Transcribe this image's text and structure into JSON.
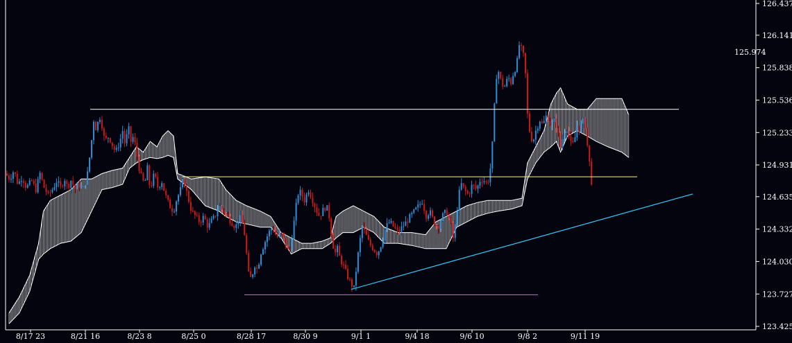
{
  "colors": {
    "background": "#04040f",
    "axis": "#ffffff",
    "up_candle": "#2a8fd6",
    "down_candle": "#d01818",
    "cloud": "#cfcfcf",
    "cloud_edge": "#ffffff",
    "resistance_1": "#ffffff",
    "resistance_2": "#ffff66",
    "support": "#ff44ff",
    "trendline": "#33ccff"
  },
  "chart_data": {
    "type": "candlestick",
    "x_axis": {
      "tick_labels": [
        "8/17 23",
        "8/21 16",
        "8/23 8",
        "8/25 0",
        "8/28 17",
        "8/30 9",
        "9/1 1",
        "9/4 18",
        "9/6 10",
        "9/8 2",
        "9/11 19"
      ]
    },
    "y_axis": {
      "ylim": [
        123.425,
        126.437
      ],
      "tick_labels": [
        "126.437",
        "126.141",
        "125.838",
        "125.536",
        "125.233",
        "124.931",
        "124.635",
        "124.332",
        "124.030",
        "123.727",
        "123.425"
      ],
      "ticks": [
        126.437,
        126.141,
        125.838,
        125.536,
        125.233,
        124.931,
        124.635,
        124.332,
        124.03,
        123.727,
        123.425
      ]
    },
    "current_price": "125.974",
    "price_path": [
      [
        0,
        124.85
      ],
      [
        6,
        124.8
      ],
      [
        12,
        124.88
      ],
      [
        18,
        124.75
      ],
      [
        24,
        124.82
      ],
      [
        30,
        124.72
      ],
      [
        38,
        124.78
      ],
      [
        44,
        124.7
      ],
      [
        50,
        124.85
      ],
      [
        56,
        124.72
      ],
      [
        62,
        124.65
      ],
      [
        68,
        124.7
      ],
      [
        74,
        124.78
      ],
      [
        80,
        124.72
      ],
      [
        86,
        124.8
      ],
      [
        90,
        124.72
      ],
      [
        96,
        124.8
      ],
      [
        100,
        124.7
      ],
      [
        106,
        124.75
      ],
      [
        112,
        124.7
      ],
      [
        118,
        124.8
      ],
      [
        124,
        125.1
      ],
      [
        128,
        125.35
      ],
      [
        132,
        125.25
      ],
      [
        136,
        125.4
      ],
      [
        140,
        125.3
      ],
      [
        144,
        125.15
      ],
      [
        150,
        125.2
      ],
      [
        156,
        125.1
      ],
      [
        160,
        125.05
      ],
      [
        166,
        125.15
      ],
      [
        170,
        125.25
      ],
      [
        174,
        125.1
      ],
      [
        178,
        125.3
      ],
      [
        182,
        125.15
      ],
      [
        186,
        125.2
      ],
      [
        190,
        125.05
      ],
      [
        194,
        124.9
      ],
      [
        198,
        124.8
      ],
      [
        202,
        124.75
      ],
      [
        206,
        124.9
      ],
      [
        210,
        124.7
      ],
      [
        216,
        124.85
      ],
      [
        222,
        124.7
      ],
      [
        226,
        124.8
      ],
      [
        232,
        124.65
      ],
      [
        238,
        124.55
      ],
      [
        244,
        124.5
      ],
      [
        248,
        124.6
      ],
      [
        254,
        124.7
      ],
      [
        258,
        124.8
      ],
      [
        262,
        124.7
      ],
      [
        266,
        124.6
      ],
      [
        270,
        124.5
      ],
      [
        276,
        124.45
      ],
      [
        282,
        124.4
      ],
      [
        288,
        124.45
      ],
      [
        294,
        124.35
      ],
      [
        298,
        124.4
      ],
      [
        304,
        124.45
      ],
      [
        310,
        124.55
      ],
      [
        316,
        124.5
      ],
      [
        322,
        124.45
      ],
      [
        328,
        124.4
      ],
      [
        334,
        124.35
      ],
      [
        340,
        124.45
      ],
      [
        346,
        124.35
      ],
      [
        350,
        124.1
      ],
      [
        354,
        123.85
      ],
      [
        358,
        123.9
      ],
      [
        362,
        124.0
      ],
      [
        366,
        123.95
      ],
      [
        370,
        124.1
      ],
      [
        376,
        124.2
      ],
      [
        382,
        124.3
      ],
      [
        388,
        124.35
      ],
      [
        394,
        124.25
      ],
      [
        400,
        124.3
      ],
      [
        406,
        124.2
      ],
      [
        412,
        124.1
      ],
      [
        418,
        124.35
      ],
      [
        422,
        124.55
      ],
      [
        426,
        124.7
      ],
      [
        430,
        124.65
      ],
      [
        434,
        124.6
      ],
      [
        440,
        124.7
      ],
      [
        446,
        124.6
      ],
      [
        452,
        124.5
      ],
      [
        456,
        124.45
      ],
      [
        460,
        124.5
      ],
      [
        466,
        124.55
      ],
      [
        470,
        124.45
      ],
      [
        474,
        124.25
      ],
      [
        478,
        124.1
      ],
      [
        482,
        124.15
      ],
      [
        486,
        124.05
      ],
      [
        490,
        124.0
      ],
      [
        496,
        123.9
      ],
      [
        502,
        123.82
      ],
      [
        506,
        123.78
      ],
      [
        510,
        124.0
      ],
      [
        514,
        124.2
      ],
      [
        518,
        124.35
      ],
      [
        522,
        124.3
      ],
      [
        528,
        124.2
      ],
      [
        534,
        124.15
      ],
      [
        540,
        124.1
      ],
      [
        546,
        124.2
      ],
      [
        552,
        124.35
      ],
      [
        558,
        124.4
      ],
      [
        564,
        124.35
      ],
      [
        570,
        124.3
      ],
      [
        576,
        124.35
      ],
      [
        582,
        124.4
      ],
      [
        588,
        124.45
      ],
      [
        594,
        124.5
      ],
      [
        600,
        124.55
      ],
      [
        606,
        124.6
      ],
      [
        610,
        124.45
      ],
      [
        616,
        124.5
      ],
      [
        622,
        124.4
      ],
      [
        628,
        124.35
      ],
      [
        634,
        124.45
      ],
      [
        640,
        124.5
      ],
      [
        646,
        124.4
      ],
      [
        650,
        124.25
      ],
      [
        654,
        124.4
      ],
      [
        658,
        124.65
      ],
      [
        662,
        124.75
      ],
      [
        666,
        124.7
      ],
      [
        672,
        124.65
      ],
      [
        678,
        124.75
      ],
      [
        684,
        124.7
      ],
      [
        690,
        124.8
      ],
      [
        696,
        124.78
      ],
      [
        700,
        124.75
      ],
      [
        704,
        124.9
      ],
      [
        708,
        125.2
      ],
      [
        712,
        125.75
      ],
      [
        716,
        125.8
      ],
      [
        720,
        125.7
      ],
      [
        724,
        125.65
      ],
      [
        730,
        125.75
      ],
      [
        734,
        125.7
      ],
      [
        738,
        125.8
      ],
      [
        742,
        125.85
      ],
      [
        746,
        126.05
      ],
      [
        750,
        126.0
      ],
      [
        754,
        125.9
      ],
      [
        758,
        125.4
      ],
      [
        762,
        125.2
      ],
      [
        766,
        125.15
      ],
      [
        770,
        125.25
      ],
      [
        776,
        125.35
      ],
      [
        780,
        125.3
      ],
      [
        786,
        125.4
      ],
      [
        792,
        125.3
      ],
      [
        798,
        125.35
      ],
      [
        802,
        125.25
      ],
      [
        806,
        125.1
      ],
      [
        810,
        125.2
      ],
      [
        814,
        125.3
      ],
      [
        818,
        125.2
      ],
      [
        822,
        125.1
      ],
      [
        826,
        125.15
      ],
      [
        830,
        125.3
      ],
      [
        834,
        125.25
      ],
      [
        838,
        125.35
      ],
      [
        842,
        125.3
      ],
      [
        846,
        125.05
      ],
      [
        850,
        124.85
      ],
      [
        852,
        124.7
      ]
    ],
    "cloud": {
      "upper": [
        [
          5,
          123.55
        ],
        [
          20,
          123.7
        ],
        [
          35,
          123.9
        ],
        [
          48,
          124.2
        ],
        [
          55,
          124.5
        ],
        [
          65,
          124.6
        ],
        [
          80,
          124.65
        ],
        [
          95,
          124.7
        ],
        [
          110,
          124.8
        ],
        [
          125,
          124.8
        ],
        [
          140,
          124.85
        ],
        [
          155,
          124.88
        ],
        [
          170,
          124.9
        ],
        [
          180,
          125.0
        ],
        [
          190,
          125.1
        ],
        [
          200,
          125.05
        ],
        [
          210,
          125.15
        ],
        [
          220,
          125.1
        ],
        [
          228,
          125.2
        ],
        [
          236,
          125.25
        ],
        [
          244,
          125.2
        ],
        [
          250,
          124.85
        ],
        [
          270,
          124.8
        ],
        [
          290,
          124.82
        ],
        [
          310,
          124.8
        ],
        [
          320,
          124.7
        ],
        [
          335,
          124.6
        ],
        [
          350,
          124.55
        ],
        [
          370,
          124.5
        ],
        [
          385,
          124.45
        ],
        [
          400,
          124.3
        ],
        [
          415,
          124.25
        ],
        [
          430,
          124.2
        ],
        [
          445,
          124.2
        ],
        [
          460,
          124.22
        ],
        [
          472,
          124.25
        ],
        [
          480,
          124.45
        ],
        [
          490,
          124.5
        ],
        [
          505,
          124.55
        ],
        [
          520,
          124.5
        ],
        [
          535,
          124.45
        ],
        [
          550,
          124.35
        ],
        [
          570,
          124.3
        ],
        [
          590,
          124.3
        ],
        [
          610,
          124.28
        ],
        [
          625,
          124.4
        ],
        [
          640,
          124.45
        ],
        [
          655,
          124.5
        ],
        [
          670,
          124.55
        ],
        [
          685,
          124.58
        ],
        [
          700,
          124.6
        ],
        [
          715,
          124.6
        ],
        [
          735,
          124.6
        ],
        [
          750,
          124.62
        ],
        [
          758,
          124.95
        ],
        [
          770,
          125.1
        ],
        [
          782,
          125.25
        ],
        [
          792,
          125.5
        ],
        [
          800,
          125.6
        ],
        [
          806,
          125.65
        ],
        [
          816,
          125.5
        ],
        [
          830,
          125.45
        ],
        [
          845,
          125.45
        ],
        [
          858,
          125.55
        ],
        [
          875,
          125.55
        ],
        [
          895,
          125.55
        ],
        [
          905,
          125.4
        ]
      ],
      "lower": [
        [
          5,
          123.45
        ],
        [
          20,
          123.55
        ],
        [
          35,
          123.75
        ],
        [
          48,
          124.05
        ],
        [
          55,
          124.1
        ],
        [
          65,
          124.15
        ],
        [
          80,
          124.2
        ],
        [
          95,
          124.22
        ],
        [
          110,
          124.3
        ],
        [
          125,
          124.5
        ],
        [
          140,
          124.7
        ],
        [
          155,
          124.72
        ],
        [
          170,
          124.75
        ],
        [
          180,
          124.9
        ],
        [
          190,
          124.95
        ],
        [
          200,
          124.98
        ],
        [
          210,
          125.0
        ],
        [
          220,
          124.99
        ],
        [
          228,
          125.0
        ],
        [
          236,
          125.02
        ],
        [
          244,
          125.0
        ],
        [
          250,
          124.8
        ],
        [
          270,
          124.7
        ],
        [
          290,
          124.55
        ],
        [
          310,
          124.5
        ],
        [
          320,
          124.45
        ],
        [
          335,
          124.4
        ],
        [
          350,
          124.38
        ],
        [
          370,
          124.35
        ],
        [
          385,
          124.35
        ],
        [
          400,
          124.25
        ],
        [
          415,
          124.1
        ],
        [
          430,
          124.15
        ],
        [
          445,
          124.15
        ],
        [
          460,
          124.15
        ],
        [
          472,
          124.2
        ],
        [
          480,
          124.25
        ],
        [
          490,
          124.3
        ],
        [
          505,
          124.3
        ],
        [
          520,
          124.35
        ],
        [
          535,
          124.3
        ],
        [
          550,
          124.2
        ],
        [
          570,
          124.2
        ],
        [
          590,
          124.18
        ],
        [
          610,
          124.15
        ],
        [
          625,
          124.15
        ],
        [
          640,
          124.15
        ],
        [
          655,
          124.35
        ],
        [
          670,
          124.4
        ],
        [
          685,
          124.45
        ],
        [
          700,
          124.48
        ],
        [
          715,
          124.5
        ],
        [
          735,
          124.52
        ],
        [
          750,
          124.55
        ],
        [
          758,
          124.8
        ],
        [
          770,
          124.95
        ],
        [
          782,
          125.05
        ],
        [
          792,
          125.1
        ],
        [
          800,
          125.15
        ],
        [
          806,
          125.05
        ],
        [
          816,
          125.2
        ],
        [
          830,
          125.25
        ],
        [
          845,
          125.2
        ],
        [
          858,
          125.15
        ],
        [
          875,
          125.1
        ],
        [
          895,
          125.05
        ],
        [
          905,
          125.0
        ]
      ]
    },
    "lines": [
      {
        "kind": "horizontal",
        "value": 125.45,
        "x_start": 130,
        "x_end": 978,
        "color_key": "resistance_1"
      },
      {
        "kind": "horizontal",
        "value": 124.82,
        "x_start": 262,
        "x_end": 918,
        "color_key": "resistance_2"
      },
      {
        "kind": "horizontal",
        "value": 123.72,
        "x_start": 352,
        "x_end": 775,
        "color_key": "support"
      },
      {
        "kind": "trend",
        "from": [
          506,
          123.77
        ],
        "to": [
          998,
          124.66
        ],
        "color_key": "trendline"
      }
    ],
    "grid": false
  }
}
